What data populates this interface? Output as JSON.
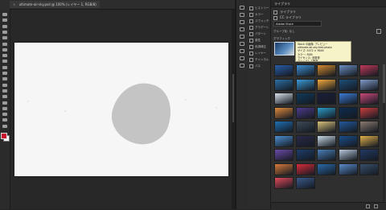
{
  "document": {
    "tab_title": "ultimate-air-sky.psd @ 100% (レイヤー 1, RGB/8)",
    "close_glyph": "×"
  },
  "toolbar": {
    "tools": [
      "move-tool-icon",
      "marquee-tool-icon",
      "lasso-tool-icon",
      "quick-select-tool-icon",
      "crop-tool-icon",
      "eyedropper-tool-icon",
      "healing-brush-tool-icon",
      "brush-tool-icon",
      "clone-stamp-tool-icon",
      "history-brush-tool-icon",
      "eraser-tool-icon",
      "gradient-tool-icon",
      "blur-tool-icon",
      "dodge-tool-icon",
      "pen-tool-icon",
      "type-tool-icon",
      "path-select-tool-icon",
      "rectangle-tool-icon",
      "hand-tool-icon",
      "zoom-tool-icon"
    ],
    "foreground_color": "#c8102e",
    "background_color": "#f5f5f5"
  },
  "collapsed_panels": [
    {
      "label": "ヒストリー"
    },
    {
      "label": "カラー"
    },
    {
      "label": "スウォッチ"
    },
    {
      "label": "グラデーション"
    },
    {
      "label": "パターン"
    },
    {
      "label": "属性"
    },
    {
      "label": "色調補正"
    },
    {
      "label": "レイヤー"
    },
    {
      "label": "チャンネル"
    },
    {
      "label": "パス"
    }
  ],
  "right_panel": {
    "tab_label": "ライブラリ",
    "rows": [
      {
        "label": "ライブラリ"
      },
      {
        "label": "CC ライブラリ"
      }
    ],
    "search_placeholder": "Adobe Stock",
    "library_selector": "グループ化: なし",
    "library_header": "グラフィック",
    "tooltip_lines": [
      "Stock の画像: プレビュー",
      "ultimate-air-sky-free-photo",
      "サイズ: 5472 × 3648",
      "カラー: RGB",
      "ライセンス: 未取得",
      "クリックして配置"
    ],
    "thumbnail_colors": [
      "#2a5ea8",
      "#3f8fd1",
      "#d48a2f",
      "#6b8fc2",
      "#c23a5a",
      "#2c6fa3",
      "#3b9ad6",
      "#f2a93b",
      "#1e4f7a",
      "#7f9bc8",
      "#d8e0ea",
      "#0f3a5c",
      "#1b1f3a",
      "#3b7bd6",
      "#c84a7a",
      "#e08a3c",
      "#4d3b8a",
      "#2a9bc7",
      "#0c2c4f",
      "#c83e3e",
      "#1f6fb2",
      "#3d4a58",
      "#d9c27a",
      "#225a9c",
      "#8a7a70",
      "#4d8fd0",
      "#2a2a4a",
      "#c8d8e6",
      "#1a4f8a",
      "#e0b04a",
      "#6c4aa8",
      "#1d3d6a",
      "#4a7fb8",
      "#b8c8da",
      "#223a66",
      "#d67a3a",
      "#d82c3a",
      "#2a6aa8",
      "#5a8acb",
      "#38506b",
      "#e24a5a",
      "#3a5a8a"
    ]
  }
}
